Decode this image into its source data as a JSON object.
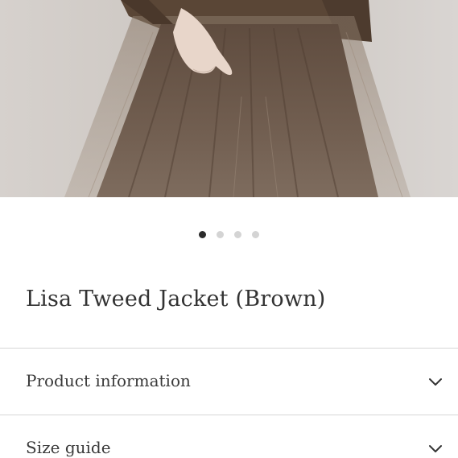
{
  "product": {
    "title": "Lisa Tweed Jacket (Brown)",
    "image_description_icon": "product-photo"
  },
  "carousel": {
    "total_slides": 4,
    "active_index": 0
  },
  "accordions": {
    "product_information": {
      "label": "Product information",
      "icon": "chevron-down-icon"
    },
    "size_guide": {
      "label": "Size guide",
      "icon": "chevron-down-icon"
    }
  },
  "colors": {
    "background": "#ffffff",
    "text": "#333333",
    "divider": "#d6d6d6",
    "dot_active": "#2b2b2b",
    "dot_inactive": "#d4d4d4",
    "skirt_brown": "#6e5a4b"
  }
}
